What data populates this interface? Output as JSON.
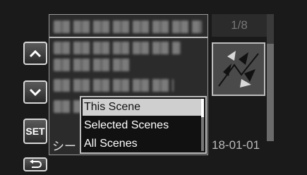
{
  "controls": {
    "up_icon": "chevron-up-icon",
    "down_icon": "chevron-down-icon",
    "set_label": "SET",
    "back_icon": "return-arrow-icon"
  },
  "list": {
    "bottom_text": "シー"
  },
  "page_counter": "1/8",
  "date": "18-01-01",
  "popup": {
    "items": [
      "This Scene",
      "Selected Scenes",
      "All Scenes"
    ],
    "selected_index": 0
  },
  "colors": {
    "background": "#1a1a1a",
    "selected_item": "#cfcfcf",
    "border": "#bdbdbd"
  }
}
